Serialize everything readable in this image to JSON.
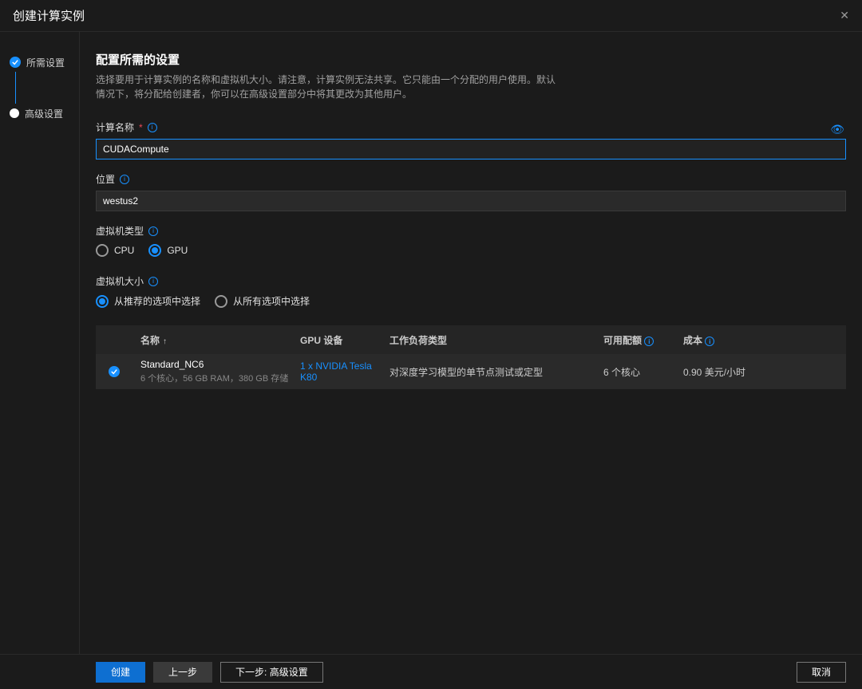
{
  "header": {
    "title": "创建计算实例"
  },
  "sidebar": {
    "steps": [
      {
        "label": "所需设置",
        "state": "done"
      },
      {
        "label": "高级设置",
        "state": "pending"
      }
    ]
  },
  "main": {
    "section_title": "配置所需的设置",
    "section_desc": "选择要用于计算实例的名称和虚拟机大小。请注意，计算实例无法共享。它只能由一个分配的用户使用。默认情况下，将分配给创建者，你可以在高级设置部分中将其更改为其他用户。",
    "name_label": "计算名称",
    "name_value": "CUDACompute",
    "location_label": "位置",
    "location_value": "westus2",
    "vm_type_label": "虚拟机类型",
    "vm_type_options": {
      "cpu": "CPU",
      "gpu": "GPU"
    },
    "vm_type_selected": "gpu",
    "vm_size_label": "虚拟机大小",
    "vm_size_options": {
      "recommended": "从推荐的选项中选择",
      "all": "从所有选项中选择"
    },
    "vm_size_selected": "recommended",
    "table": {
      "headers": {
        "name": "名称",
        "gpu": "GPU 设备",
        "workload": "工作负荷类型",
        "quota": "可用配额",
        "cost": "成本"
      },
      "rows": [
        {
          "name": "Standard_NC6",
          "specs": "6 个核心，56 GB RAM，380 GB 存储",
          "gpu": "1 x NVIDIA Tesla K80",
          "workload": "对深度学习模型的单节点测试或定型",
          "quota": "6 个核心",
          "cost": "0.90 美元/小时",
          "selected": true
        }
      ]
    }
  },
  "footer": {
    "create": "创建",
    "back": "上一步",
    "next": "下一步: 高级设置",
    "cancel": "取消"
  }
}
